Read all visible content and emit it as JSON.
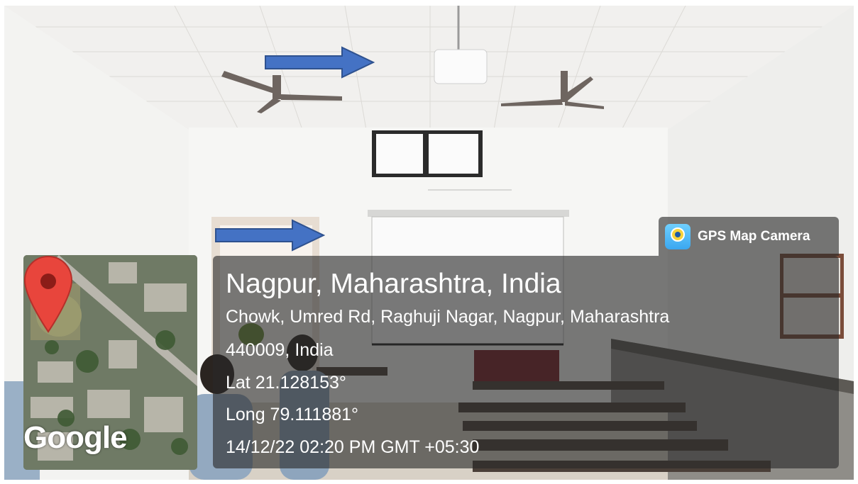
{
  "app": {
    "name": "GPS Map Camera",
    "icon": "gps-map-camera-icon"
  },
  "location": {
    "place": "Nagpur, Maharashtra, India",
    "address_line1": "Chowk, Umred Rd, Raghuji Nagar, Nagpur, Maharashtra",
    "address_line2": "440009, India",
    "latitude": "Lat 21.128153°",
    "longitude": "Long 79.111881°",
    "datetime": "14/12/22 02:20 PM GMT +05:30"
  },
  "map": {
    "provider_logo": "Google",
    "pin_icon": "map-pin-icon",
    "pin_color": "#e8453c"
  },
  "annotations": {
    "arrow_color": "#4472c4"
  }
}
